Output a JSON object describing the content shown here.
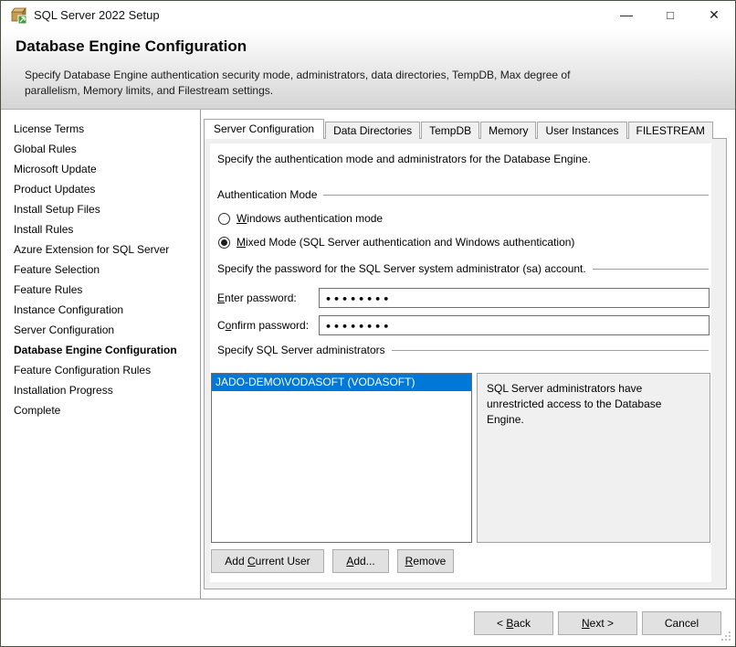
{
  "window": {
    "title": "SQL Server 2022 Setup",
    "minimize_glyph": "—",
    "maximize_glyph": "□",
    "close_glyph": "✕"
  },
  "header": {
    "title": "Database Engine Configuration",
    "description": "Specify Database Engine authentication security mode, administrators, data directories, TempDB, Max degree of parallelism, Memory limits, and Filestream settings."
  },
  "sidebar": {
    "current": "Database Engine Configuration",
    "items": [
      "License Terms",
      "Global Rules",
      "Microsoft Update",
      "Product Updates",
      "Install Setup Files",
      "Install Rules",
      "Azure Extension for SQL Server",
      "Feature Selection",
      "Feature Rules",
      "Instance Configuration",
      "Server Configuration",
      "Database Engine Configuration",
      "Feature Configuration Rules",
      "Installation Progress",
      "Complete"
    ]
  },
  "tabs": {
    "active_index": 0,
    "items": [
      "Server Configuration",
      "Data Directories",
      "TempDB",
      "Memory",
      "User Instances",
      "FILESTREAM"
    ]
  },
  "content": {
    "instruction": "Specify the authentication mode and administrators for the Database Engine.",
    "auth_group": "Authentication Mode",
    "windows_auth": {
      "pre": "",
      "key": "W",
      "post": "indows authentication mode",
      "selected": false
    },
    "mixed_mode": {
      "pre": "",
      "key": "M",
      "post": "ixed Mode (SQL Server authentication and Windows authentication)",
      "selected": true
    },
    "password_group": "Specify the password for the SQL Server system administrator (sa) account.",
    "enter_password_label": {
      "pre": "",
      "key": "E",
      "post": "nter password:"
    },
    "confirm_password_label": {
      "pre": "C",
      "key": "o",
      "post": "nfirm password:"
    },
    "enter_password_value": "••••••••",
    "confirm_password_value": "••••••••",
    "admins_group": "Specify SQL Server administrators",
    "admins": {
      "selected_index": 0,
      "items": [
        "JADO-DEMO\\VODASOFT (VODASOFT)"
      ],
      "note": "SQL Server administrators have unrestricted access to the Database Engine."
    },
    "buttons": {
      "add_current_user": {
        "pre": "Add ",
        "key": "C",
        "post": "urrent User"
      },
      "add": {
        "pre": "",
        "key": "A",
        "post": "dd..."
      },
      "remove": {
        "pre": "",
        "key": "R",
        "post": "emove"
      }
    }
  },
  "footer": {
    "back": {
      "pre": "< ",
      "key": "B",
      "post": "ack"
    },
    "next": {
      "pre": "",
      "key": "N",
      "post": "ext >"
    },
    "cancel": "Cancel"
  },
  "colors": {
    "selection_blue": "#0078d7",
    "panel_gray": "#f0f0f0",
    "header_gradient_end": "#d5d5d5"
  }
}
